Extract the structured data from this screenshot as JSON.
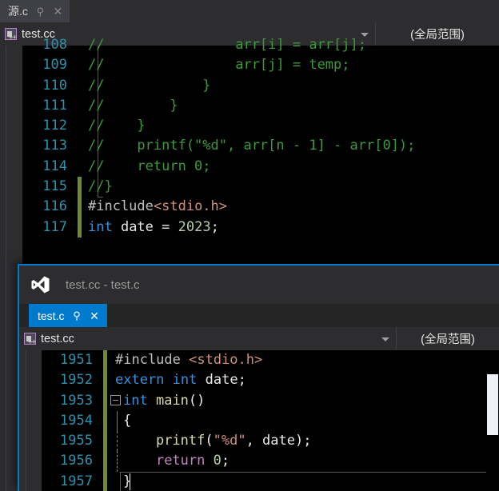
{
  "outer_window": {
    "tab": {
      "label": "源.c",
      "pin_icon": "pin-icon",
      "close_icon": "close-icon"
    },
    "navbar": {
      "file_icon": "cpp-file-icon",
      "file_name": "test.cc",
      "dropdown_icon": "chevron-down-icon",
      "scope": "(全局范围)"
    },
    "editor": {
      "lines": [
        {
          "num": "108",
          "changed": false,
          "tokens": [
            {
              "t": "//                arr[i] = arr[j];",
              "c": "cmt"
            }
          ]
        },
        {
          "num": "109",
          "changed": false,
          "tokens": [
            {
              "t": "//                arr[j] = temp;",
              "c": "cmt"
            }
          ]
        },
        {
          "num": "110",
          "changed": false,
          "tokens": [
            {
              "t": "//            }",
              "c": "cmt"
            }
          ]
        },
        {
          "num": "111",
          "changed": false,
          "tokens": [
            {
              "t": "//        }",
              "c": "cmt"
            }
          ]
        },
        {
          "num": "112",
          "changed": false,
          "tokens": [
            {
              "t": "//    }",
              "c": "cmt"
            }
          ]
        },
        {
          "num": "113",
          "changed": false,
          "tokens": [
            {
              "t": "//    printf(\"%d\", arr[n - 1] - arr[0]);",
              "c": "cmt"
            }
          ]
        },
        {
          "num": "114",
          "changed": false,
          "tokens": [
            {
              "t": "//    return 0;",
              "c": "cmt"
            }
          ]
        },
        {
          "num": "115",
          "changed": true,
          "tokens": [
            {
              "t": "//}",
              "c": "cmt"
            }
          ]
        },
        {
          "num": "116",
          "changed": true,
          "tokens": [
            {
              "t": "#include",
              "c": "pp"
            },
            {
              "t": "<stdio.h>",
              "c": "hdr"
            }
          ]
        },
        {
          "num": "117",
          "changed": true,
          "tokens": [
            {
              "t": "int",
              "c": "kw"
            },
            {
              "t": " date = ",
              "c": "plain"
            },
            {
              "t": "2023",
              "c": "num"
            },
            {
              "t": ";",
              "c": "plain"
            }
          ]
        }
      ]
    }
  },
  "inner_window": {
    "titlebar": {
      "logo_icon": "visual-studio-logo-icon",
      "title": "test.cc - test.c"
    },
    "tab": {
      "label": "test.c",
      "pin_icon": "pin-icon",
      "close_icon": "close-icon"
    },
    "navbar": {
      "file_icon": "cpp-file-icon",
      "file_name": "test.cc",
      "dropdown_icon": "chevron-down-icon",
      "scope": "(全局范围)"
    },
    "editor": {
      "lines": [
        {
          "num": "1951",
          "changed": true,
          "tokens": [
            {
              "t": "#include ",
              "c": "pp"
            },
            {
              "t": "<stdio.h>",
              "c": "hdr"
            }
          ]
        },
        {
          "num": "1952",
          "changed": true,
          "tokens": [
            {
              "t": "extern",
              "c": "kw"
            },
            {
              "t": " ",
              "c": "plain"
            },
            {
              "t": "int",
              "c": "kw"
            },
            {
              "t": " date;",
              "c": "plain"
            }
          ]
        },
        {
          "num": "1953",
          "changed": true,
          "tokens": [
            {
              "t": "int",
              "c": "kw"
            },
            {
              "t": " ",
              "c": "plain"
            },
            {
              "t": "main",
              "c": "fn"
            },
            {
              "t": "()",
              "c": "plain"
            }
          ]
        },
        {
          "num": "1954",
          "changed": true,
          "tokens": [
            {
              "t": "{",
              "c": "plain"
            }
          ]
        },
        {
          "num": "1955",
          "changed": true,
          "tokens": [
            {
              "t": "    ",
              "c": "plain"
            },
            {
              "t": "printf",
              "c": "fn"
            },
            {
              "t": "(",
              "c": "plain"
            },
            {
              "t": "\"%d\"",
              "c": "str"
            },
            {
              "t": ", date);",
              "c": "plain"
            }
          ]
        },
        {
          "num": "1956",
          "changed": true,
          "tokens": [
            {
              "t": "    ",
              "c": "plain"
            },
            {
              "t": "return",
              "c": "kw2"
            },
            {
              "t": " ",
              "c": "plain"
            },
            {
              "t": "0",
              "c": "num"
            },
            {
              "t": ";",
              "c": "plain"
            }
          ]
        },
        {
          "num": "1957",
          "changed": true,
          "tokens": [
            {
              "t": "}",
              "c": "plain"
            }
          ]
        }
      ],
      "scrollbar_icon": "vertical-scrollbar"
    }
  },
  "colors": {
    "accent_blue": "#007acc",
    "editor_background": "#000000",
    "chrome_background": "#2d2d30",
    "line_number": "#2b91af",
    "comment_green": "#3b9a3b",
    "keyword_blue": "#3a8fd8",
    "string_orange": "#cf9178",
    "number_green": "#b5cea8",
    "function_yellow": "#dcdcaa",
    "change_bar_green": "#6a8c3a"
  }
}
